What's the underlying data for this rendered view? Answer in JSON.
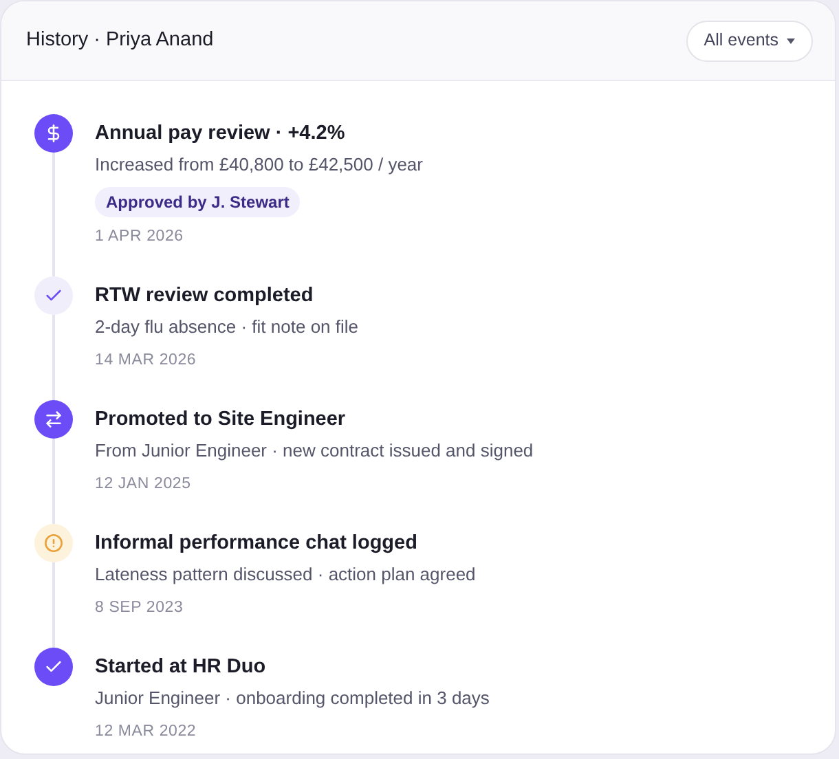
{
  "header": {
    "title": "History · Priya Anand",
    "filter": "All events"
  },
  "events": [
    {
      "kind": "pay",
      "title": "Annual pay review · +4.2%",
      "detail": "Increased from £40,800 to £42,500 / year",
      "badge": "Approved by J. Stewart",
      "date": "1 APR 2026"
    },
    {
      "kind": "review",
      "title": "RTW review completed",
      "detail": "2-day flu absence · fit note on file",
      "date": "14 MAR 2026"
    },
    {
      "kind": "promotion",
      "title": "Promoted to Site Engineer",
      "detail": "From Junior Engineer · new contract issued and signed",
      "date": "12 JAN 2025"
    },
    {
      "kind": "warning",
      "title": "Informal performance chat logged",
      "detail": "Lateness pattern discussed · action plan agreed",
      "date": "8 SEP 2023"
    },
    {
      "kind": "start",
      "title": "Started at HR Duo",
      "detail": "Junior Engineer · onboarding completed in 3 days",
      "date": "12 MAR 2022"
    }
  ]
}
